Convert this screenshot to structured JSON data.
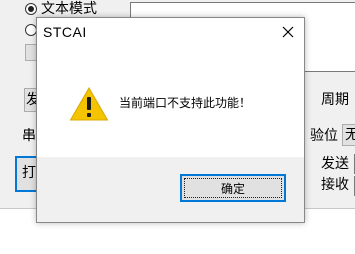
{
  "background": {
    "text_mode_radio_label": "文本模式",
    "send_button_partial": "发",
    "period_label": "周期",
    "serial_label_partial": "串",
    "parity_label": "验位",
    "parity_value_partial": "无",
    "open_button_partial": "打",
    "send_label": "发送",
    "receive_label": "接收"
  },
  "dialog": {
    "title": "STCAI",
    "message": "当前端口不支持此功能！",
    "ok_label": "确定",
    "icon": "warning-icon",
    "close_icon": "close-icon"
  },
  "colors": {
    "accent": "#0078d7",
    "warning_fill": "#f5c400",
    "footer_bg": "#f0f0f0"
  }
}
